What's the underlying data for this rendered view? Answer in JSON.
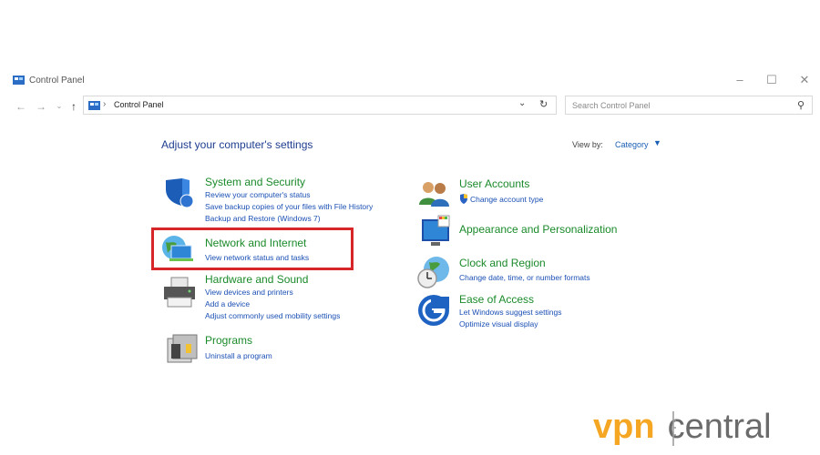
{
  "window": {
    "title": "Control Panel"
  },
  "address_bar": {
    "path_item": "Control Panel"
  },
  "search": {
    "placeholder": "Search Control Panel"
  },
  "page": {
    "title": "Adjust your computer's settings"
  },
  "view_by": {
    "label": "View by:",
    "value": "Category"
  },
  "categories": [
    {
      "icon": "shield-icon",
      "title": "System and Security",
      "links": [
        "Review your computer's status",
        "Save backup copies of your files with File History",
        "Backup and Restore (Windows 7)"
      ]
    },
    {
      "icon": "network-globe-icon",
      "title": "Network and Internet",
      "links": [
        "View network status and tasks"
      ]
    },
    {
      "icon": "printer-icon",
      "title": "Hardware and Sound",
      "links": [
        "View devices and printers",
        "Add a device",
        "Adjust commonly used mobility settings"
      ]
    },
    {
      "icon": "programs-icon",
      "title": "Programs",
      "links": [
        "Uninstall a program"
      ]
    },
    {
      "icon": "users-icon",
      "title": "User Accounts",
      "links": [
        "Change account type"
      ]
    },
    {
      "icon": "monitor-icon",
      "title": "Appearance and Personalization",
      "links": []
    },
    {
      "icon": "clock-globe-icon",
      "title": "Clock and Region",
      "links": [
        "Change date, time, or number formats"
      ]
    },
    {
      "icon": "accessibility-icon",
      "title": "Ease of Access",
      "links": [
        "Let Windows suggest settings",
        "Optimize visual display"
      ]
    }
  ],
  "colors": {
    "category_title": "#1a8a2a",
    "link": "#1a4fb4",
    "highlight_border": "#d6262a",
    "brand_orange": "#f5a623"
  },
  "watermark": {
    "part1": "vpn",
    "part2": "central"
  }
}
